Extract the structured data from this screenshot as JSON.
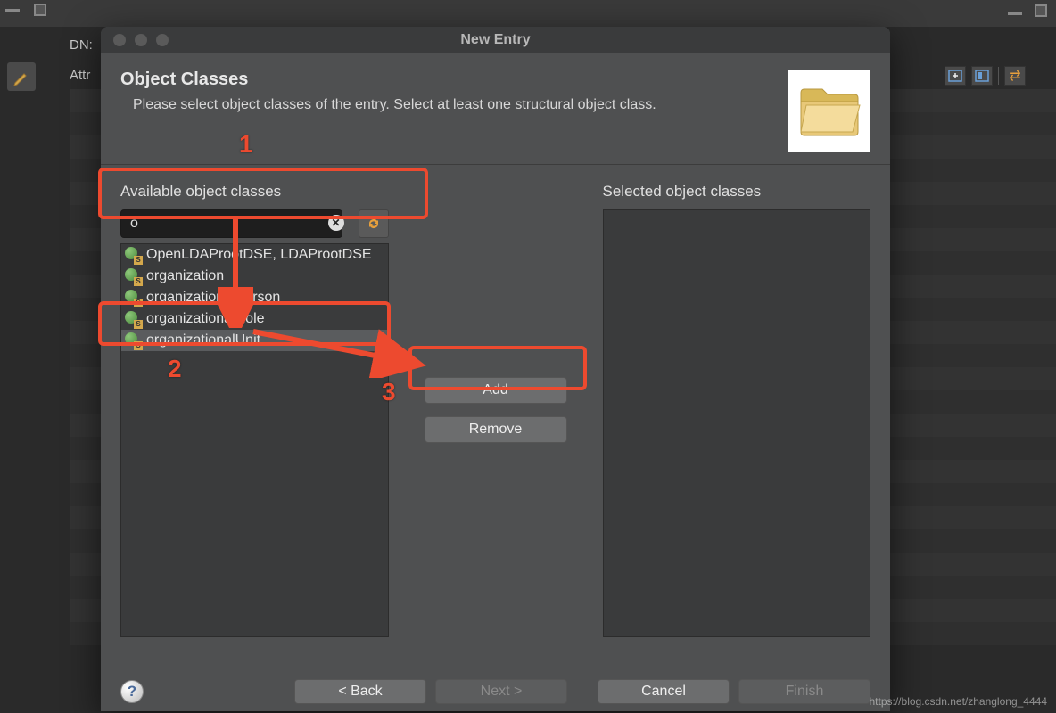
{
  "bgToolbar": {
    "dnLabel": "DN:",
    "attrLabel": "Attr"
  },
  "dialog": {
    "title": "New Entry",
    "header": {
      "heading": "Object Classes",
      "subtext": "Please select object classes of the entry. Select at least one structural object class."
    },
    "available": {
      "label": "Available object classes",
      "searchValue": "o",
      "items": [
        "OpenLDAProotDSE, LDAProotDSE",
        "organization",
        "organizationalPerson",
        "organizationalRole",
        "organizationalUnit"
      ]
    },
    "selected": {
      "label": "Selected object classes"
    },
    "buttons": {
      "add": "Add",
      "remove": "Remove"
    },
    "footer": {
      "back": "< Back",
      "next": "Next >",
      "cancel": "Cancel",
      "finish": "Finish"
    }
  },
  "annotations": {
    "n1": "1",
    "n2": "2",
    "n3": "3"
  },
  "watermark": "https://blog.csdn.net/zhanglong_4444"
}
